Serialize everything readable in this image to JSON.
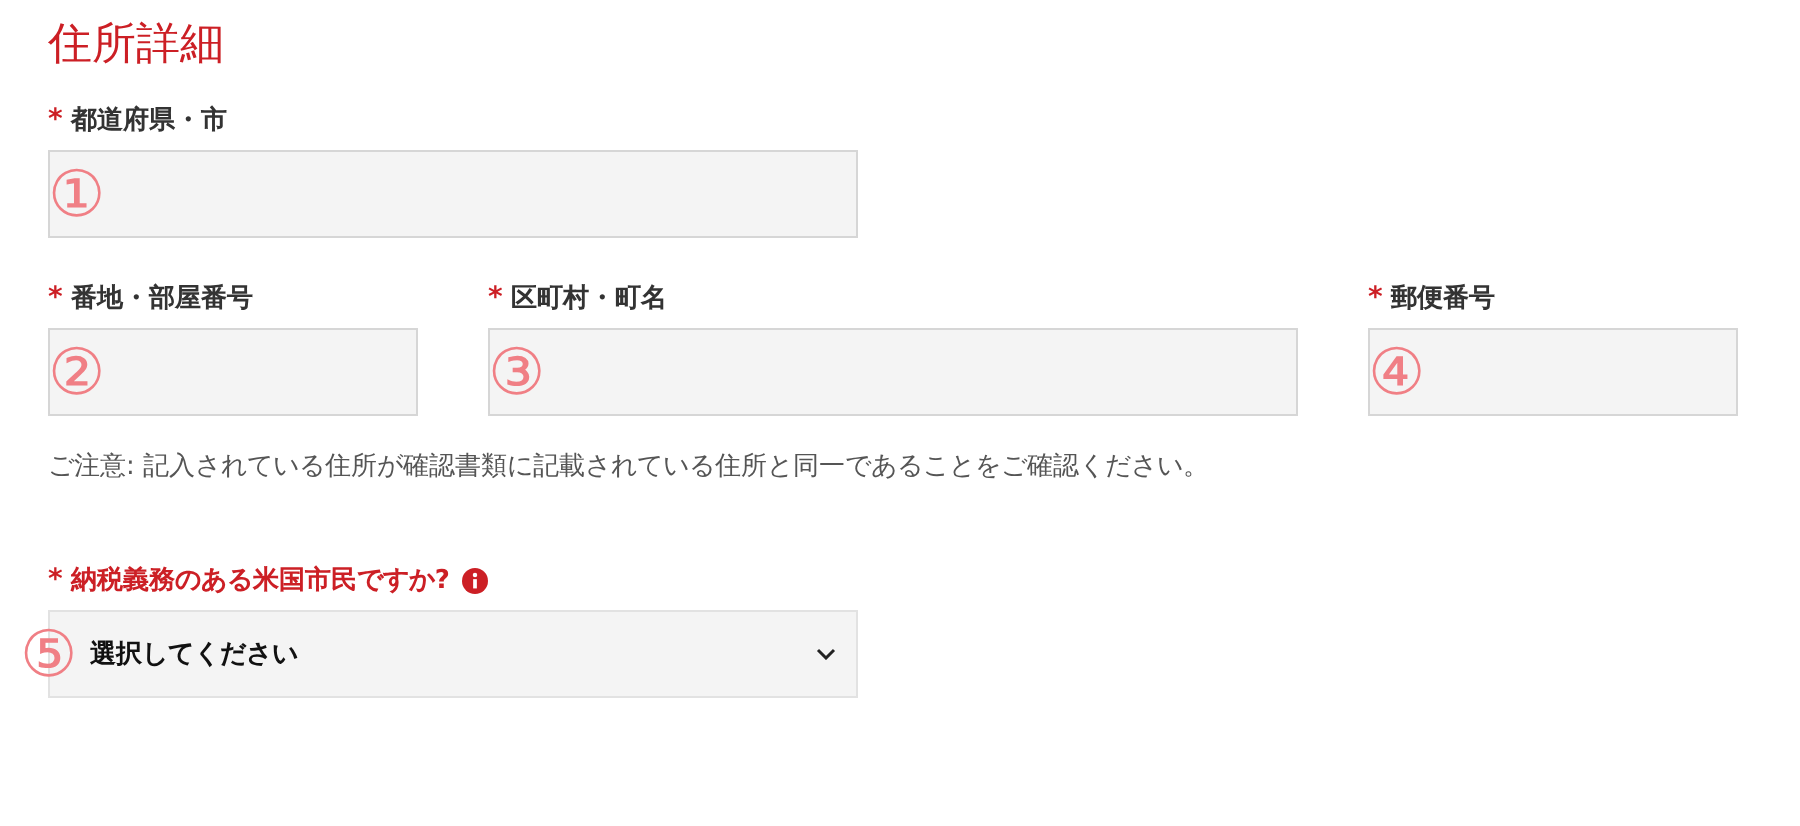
{
  "title": "住所詳細",
  "rows": [
    [
      {
        "kind": "text",
        "required_mark": "*",
        "label": "都道府県・市",
        "annotation": "①"
      }
    ],
    [
      {
        "kind": "text",
        "required_mark": "*",
        "label": "番地・部屋番号",
        "annotation": "②"
      },
      {
        "kind": "text",
        "required_mark": "*",
        "label": "区町村・町名",
        "annotation": "③"
      },
      {
        "kind": "text",
        "required_mark": "*",
        "label": "郵便番号",
        "annotation": "④"
      }
    ]
  ],
  "note": "ご注意: 記入されている住所が確認書類に記載されている住所と同一であることをご確認ください。",
  "question": {
    "kind": "select",
    "required_mark": "*",
    "label": "納税義務のある米国市民ですか?",
    "highlighted": true,
    "info": true,
    "value": "選択してください",
    "annotation": "⑤"
  }
}
